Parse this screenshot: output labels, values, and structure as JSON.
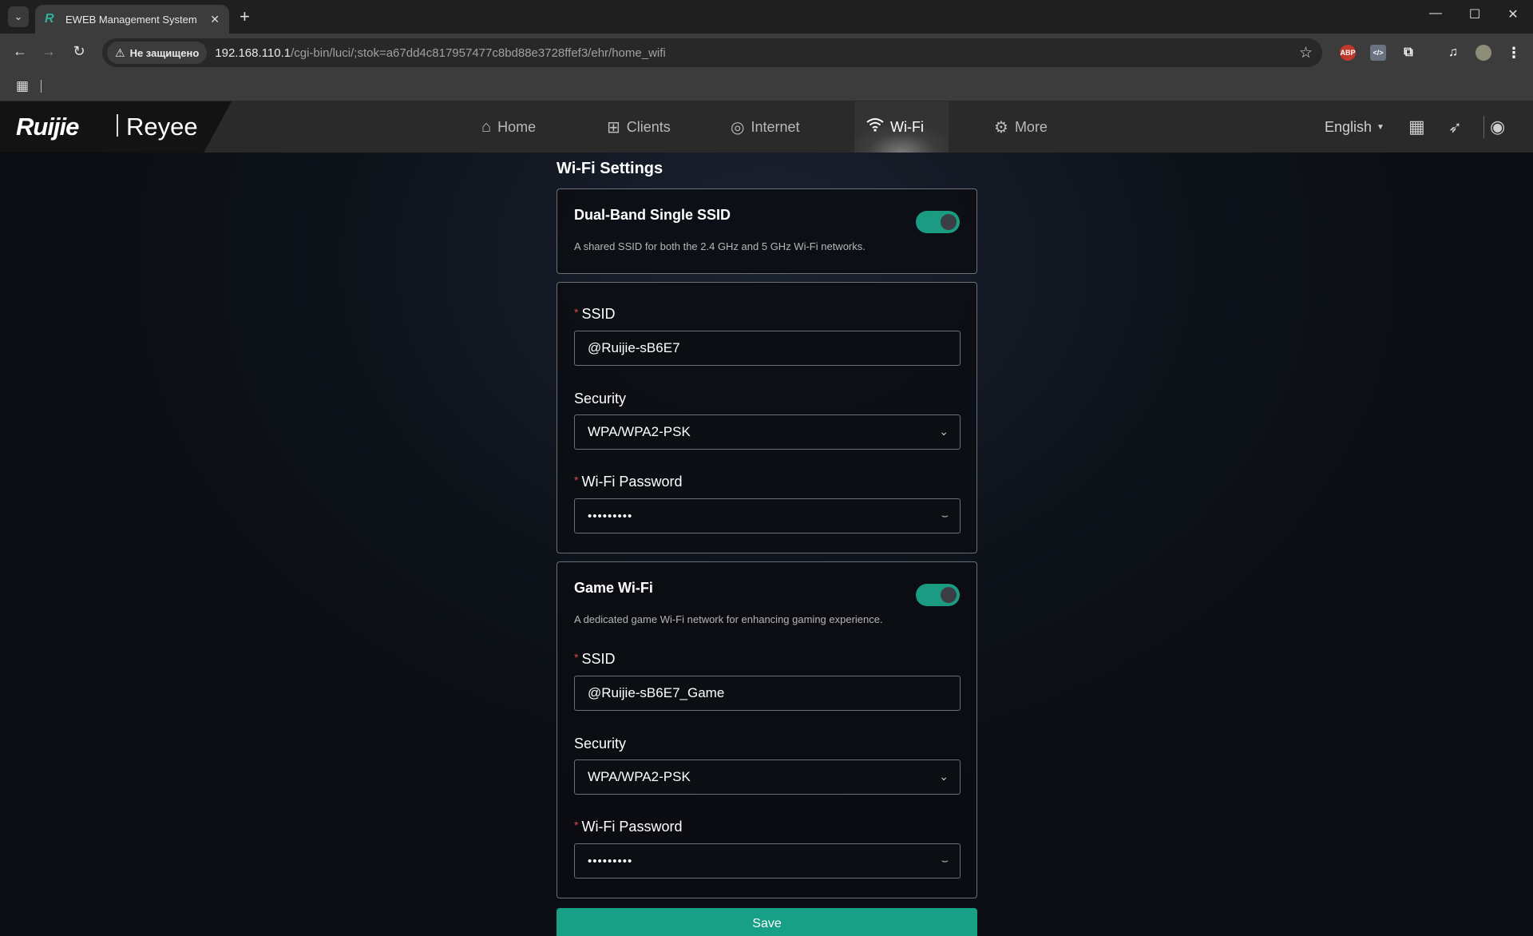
{
  "browser": {
    "tab_title": "EWEB Management System",
    "security_chip": "Не защищено",
    "url_host": "192.168.110.1",
    "url_path": "/cgi-bin/luci/;stok=a67dd4c817957477c8bd88e3728ffef3/ehr/home_wifi",
    "ext_abp": "ABP"
  },
  "header": {
    "logo_brand": "Ruijie",
    "logo_product": "Reyee",
    "nav": {
      "home": "Home",
      "clients": "Clients",
      "internet": "Internet",
      "wifi": "Wi-Fi",
      "more": "More"
    },
    "active_nav": "Wi-Fi",
    "language": "English"
  },
  "page": {
    "title": "Wi-Fi Settings",
    "dual_band": {
      "title": "Dual-Band Single SSID",
      "description": "A shared SSID for both the 2.4 GHz and 5 GHz Wi-Fi networks.",
      "enabled": true
    },
    "main_wifi": {
      "ssid_label": "SSID",
      "ssid_value": "@Ruijie-sB6E7",
      "security_label": "Security",
      "security_value": "WPA/WPA2-PSK",
      "password_label": "Wi-Fi Password",
      "password_masked": "•••••••••"
    },
    "game_wifi": {
      "title": "Game Wi-Fi",
      "description": "A dedicated game Wi-Fi network for enhancing gaming experience.",
      "enabled": true,
      "ssid_label": "SSID",
      "ssid_value": "@Ruijie-sB6E7_Game",
      "security_label": "Security",
      "security_value": "WPA/WPA2-PSK",
      "password_label": "Wi-Fi Password",
      "password_masked": "•••••••••"
    },
    "save_label": "Save"
  },
  "colors": {
    "accent": "#17a086",
    "toggle_on": "#1a9b82",
    "required": "#e5484d"
  }
}
